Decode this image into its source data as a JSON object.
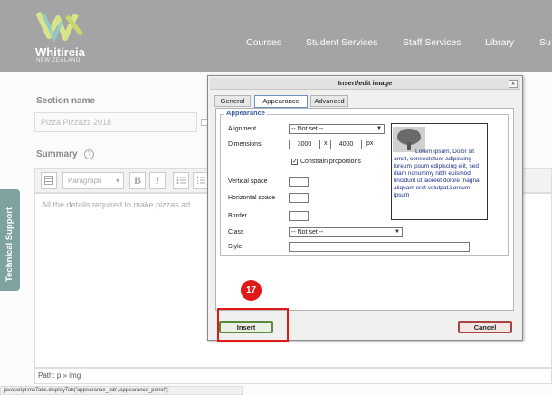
{
  "header": {
    "logo_name": "Whitireia",
    "logo_sub": "NEW ZEALAND",
    "nav": [
      "Courses",
      "Student Services",
      "Staff Services",
      "Library",
      "Su"
    ]
  },
  "form": {
    "section_label": "Section name",
    "section_value": "Pizza Pizzazz 2018",
    "summary_label": "Summary",
    "help_glyph": "?",
    "format_value": "Paragraph",
    "toolbar_glyphs": [
      "B",
      "I"
    ],
    "editor_text": "All the details required to make pizzas ad",
    "path": "Path: p » img"
  },
  "status_url": "javascript:mcTabs.displayTab('appearance_tab','appearance_panel');",
  "tech_support": "Technical Support",
  "dialog": {
    "title": "Insert/edit image",
    "close_glyph": "x",
    "tabs": [
      "General",
      "Appearance",
      "Advanced"
    ],
    "active_tab": "Appearance",
    "legend": "Appearance",
    "labels": {
      "alignment": "Alignment",
      "dimensions": "Dimensions",
      "vertical_space": "Vertical space",
      "horizontal_space": "Horizontal space",
      "border": "Border",
      "class": "Class",
      "style": "Style"
    },
    "alignment_value": "-- Not set --",
    "width": "3000",
    "height": "4000",
    "times": "x",
    "unit": "px",
    "constrain_label": "Constrain proportions",
    "constrain_checked": "✓",
    "class_value": "-- Not set --",
    "preview_text": "Lorem ipsum, Dolor sit amet, consectetuer adipiscing loreum ipsum edipiscing elit, sed diam nonummy nibh euismod tincidunt ut laoreet dolore magna aliquam erat volutpat.Loreum ipsum",
    "insert_label": "Insert",
    "cancel_label": "Cancel"
  },
  "annotation": {
    "step": "17",
    "color": "#e01818"
  }
}
